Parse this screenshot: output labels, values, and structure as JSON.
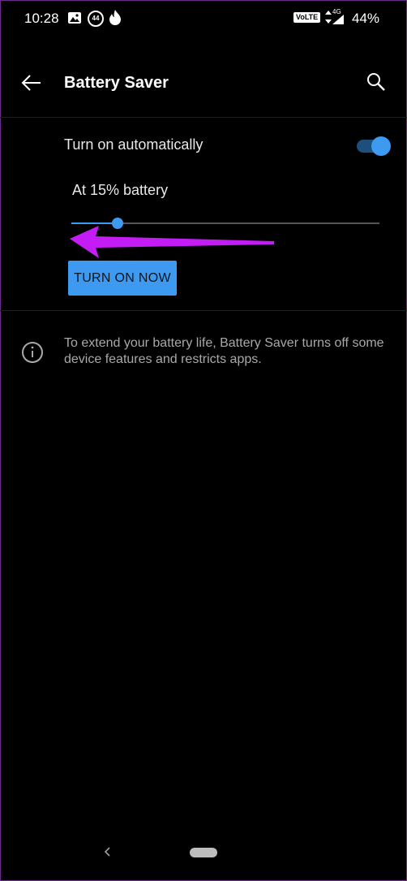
{
  "status_bar": {
    "time": "10:28",
    "notification_badge": "44",
    "volte_label": "VoLTE",
    "network_label": "4G",
    "battery_percent": "44%",
    "icons": [
      "image-icon",
      "badge-44-icon",
      "fire-icon",
      "volte-icon",
      "data-arrows-icon",
      "signal-icon",
      "battery-icon"
    ]
  },
  "app_bar": {
    "title": "Battery Saver",
    "back_icon": "arrow-left-icon",
    "search_icon": "search-icon"
  },
  "auto_setting": {
    "label": "Turn on automatically",
    "toggle_on": true
  },
  "level": {
    "label": "At 15% battery",
    "slider_fraction": 0.15
  },
  "actions": {
    "turn_on_now_label": "TURN ON NOW"
  },
  "info": {
    "icon": "info-icon",
    "text": "To extend your battery life, Battery Saver turns off some device features and restricts apps."
  },
  "nav_bar": {
    "back_icon": "chevron-left-icon",
    "home_icon": "home-pill-icon"
  },
  "colors": {
    "background": "#000000",
    "accent": "#3d9af0",
    "annotation_arrow": "#c41cf5",
    "secondary_text": "#a9a9a9"
  }
}
